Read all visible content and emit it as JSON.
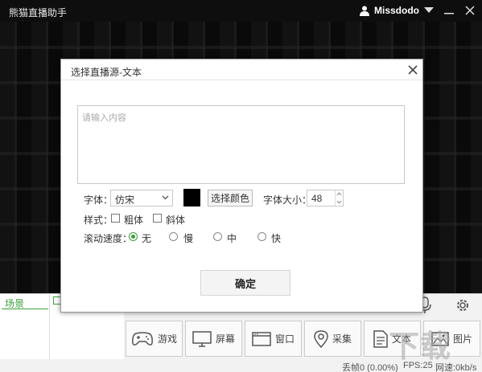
{
  "titlebar": {
    "app_title": "熊猫直播助手",
    "user_name": "Missdodo"
  },
  "modal": {
    "title": "选择直播源-文本",
    "textarea_placeholder": "请输入内容",
    "font_label": "字体：",
    "font_value": "仿宋",
    "choose_color_label": "选择颜色",
    "font_color": "#000000",
    "font_size_label": "字体大小：",
    "font_size_value": "48",
    "style_label": "样式：",
    "bold_label": "粗体",
    "italic_label": "斜体",
    "speed_label": "滚动速度：",
    "speed_options": [
      "无",
      "慢",
      "中",
      "快"
    ],
    "speed_selected": "无",
    "confirm_label": "确定"
  },
  "bottom": {
    "scene_label": "场景",
    "source_buttons": [
      "游戏",
      "屏幕",
      "窗口",
      "采集",
      "文本",
      "图片"
    ]
  },
  "status": {
    "dropped": "丢帧0 (0.00%)",
    "fps": "FPS:25",
    "net": "网速:0kb/s"
  },
  "accent_color": "#3aa03a",
  "watermark_text": "下载"
}
